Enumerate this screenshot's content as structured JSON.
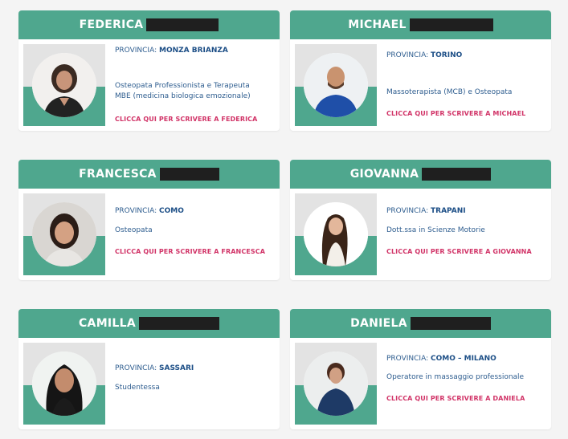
{
  "labels": {
    "provincia": "PROVINCIA:"
  },
  "colors": {
    "accent": "#4fa78e",
    "link": "#d13367",
    "text": "#2e5d8f",
    "redaction": "#1f1f1f"
  },
  "cards": [
    {
      "name": "FEDERICA",
      "provincia": "MONZA BRIANZA",
      "description": "Osteopata Professionista e Terapeuta MBE (medicina biologica emozionale)",
      "cta": "CLICCA QUI PER SCRIVERE A FEDERICA",
      "icon": "person-photo"
    },
    {
      "name": "MICHAEL",
      "provincia": "TORINO",
      "description": "Massoterapista (MCB) e Osteopata",
      "cta": "CLICCA QUI PER SCRIVERE A MICHAEL",
      "icon": "person-photo"
    },
    {
      "name": "FRANCESCA",
      "provincia": "COMO",
      "description": "Osteopata",
      "cta": "CLICCA QUI PER SCRIVERE A FRANCESCA",
      "icon": "person-photo"
    },
    {
      "name": "GIOVANNA",
      "provincia": "TRAPANI",
      "description": "Dott.ssa in Scienze Motorie",
      "cta": "CLICCA QUI PER SCRIVERE A GIOVANNA",
      "icon": "person-photo"
    },
    {
      "name": "CAMILLA",
      "provincia": "SASSARI",
      "description": "Studentessa",
      "cta": "",
      "icon": "person-photo"
    },
    {
      "name": "DANIELA",
      "provincia": "COMO – MILANO",
      "description": "Operatore in massaggio professionale",
      "cta": "CLICCA QUI PER SCRIVERE A DANIELA",
      "icon": "person-photo"
    }
  ]
}
